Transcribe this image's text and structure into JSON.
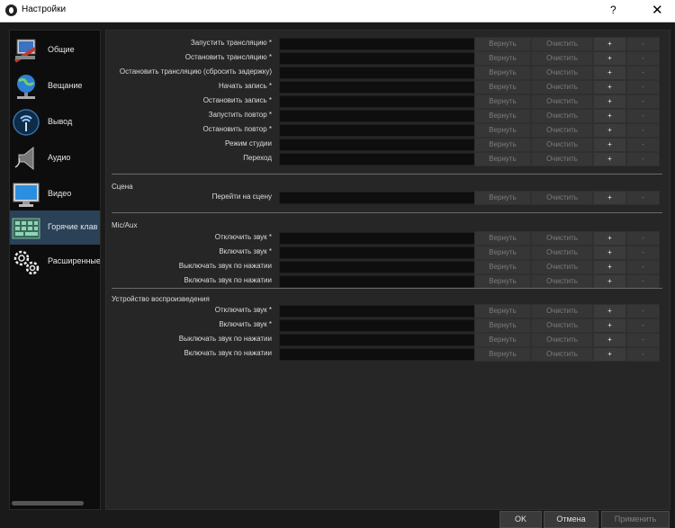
{
  "window": {
    "title": "Настройки",
    "help": "?",
    "close": "✕"
  },
  "sidebar": {
    "items": [
      {
        "label": "Общие",
        "icon": "general-settings-icon"
      },
      {
        "label": "Вещание",
        "icon": "globe-broadcast-icon"
      },
      {
        "label": "Вывод",
        "icon": "output-signal-icon"
      },
      {
        "label": "Аудио",
        "icon": "speaker-audio-icon"
      },
      {
        "label": "Видео",
        "icon": "monitor-video-icon"
      },
      {
        "label": "Горячие клав",
        "icon": "keyboard-hotkeys-icon",
        "active": true
      },
      {
        "label": "Расширенные",
        "icon": "gears-advanced-icon"
      }
    ]
  },
  "buttons": {
    "revert": "Вернуть",
    "clear": "Очистить",
    "add": "+",
    "remove": "-"
  },
  "sections": [
    {
      "title": "",
      "rows": [
        "Запустить трансляцию *",
        "Остановить трансляцию *",
        "Остановить трансляцию (сбросить задержку)",
        "Начать запись *",
        "Остановить запись *",
        "Запустить повтор *",
        "Остановить повтор *",
        "Режим студии",
        "Переход"
      ]
    },
    {
      "title": "Сцена",
      "rows": [
        "Перейти на сцену"
      ]
    },
    {
      "title": "Mic/Aux",
      "rows": [
        "Отключить звук *",
        "Включить звук *",
        "Выключать звук по нажатии",
        "Включать звук по нажатии"
      ]
    },
    {
      "title": "Устройство воспроизведения",
      "rows": [
        "Отключить звук *",
        "Включить звук *",
        "Выключать звук по нажатии",
        "Включать звук по нажатии"
      ]
    }
  ],
  "footer": {
    "ok": "OK",
    "cancel": "Отмена",
    "apply": "Применить"
  },
  "colors": {
    "active_item": "#2a4157",
    "background": "#262626"
  }
}
